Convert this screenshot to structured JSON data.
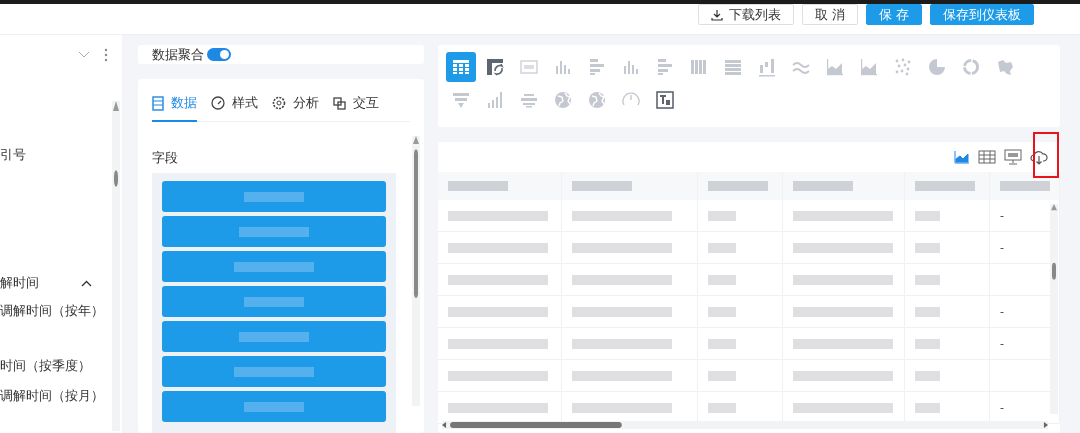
{
  "header": {
    "buttons": [
      {
        "label": "下载列表",
        "kind": "download"
      },
      {
        "label": "取 消",
        "kind": "plain"
      },
      {
        "label": "保 存",
        "kind": "primary"
      },
      {
        "label": "保存到仪表板",
        "kind": "primary"
      }
    ]
  },
  "sidebar": {
    "items": [
      {
        "label": "引号",
        "kind": "item"
      },
      {
        "label": "解时间",
        "kind": "group",
        "expanded": true
      },
      {
        "label": "调解时间（按年）",
        "kind": "item"
      },
      {
        "label": "时间（按季度）",
        "kind": "item"
      },
      {
        "label": "调解时间（按月）",
        "kind": "item"
      }
    ]
  },
  "aggregation": {
    "label": "数据聚合",
    "on": true
  },
  "tabs": [
    {
      "label": "数据",
      "kind": "data",
      "selected": true
    },
    {
      "label": "样式",
      "kind": "style",
      "selected": false
    },
    {
      "label": "分析",
      "kind": "analysis",
      "selected": false
    },
    {
      "label": "交互",
      "kind": "interaction",
      "selected": false
    }
  ],
  "fields": {
    "label": "字段"
  },
  "chart_types": [
    {
      "kind": "table",
      "selected": true,
      "disabled": false
    },
    {
      "kind": "pivot",
      "selected": false,
      "disabled": false
    },
    {
      "kind": "number",
      "selected": false,
      "disabled": true
    },
    {
      "kind": "column",
      "selected": false,
      "disabled": true
    },
    {
      "kind": "hbar",
      "selected": false,
      "disabled": true
    },
    {
      "kind": "column",
      "selected": false,
      "disabled": true
    },
    {
      "kind": "hbar",
      "selected": false,
      "disabled": true
    },
    {
      "kind": "vstripes",
      "selected": false,
      "disabled": true
    },
    {
      "kind": "hstripes",
      "selected": false,
      "disabled": true
    },
    {
      "kind": "waterfall",
      "selected": false,
      "disabled": true
    },
    {
      "kind": "wave",
      "selected": false,
      "disabled": true
    },
    {
      "kind": "area",
      "selected": false,
      "disabled": true
    },
    {
      "kind": "area",
      "selected": false,
      "disabled": true
    },
    {
      "kind": "scatter",
      "selected": false,
      "disabled": true
    },
    {
      "kind": "pie",
      "selected": false,
      "disabled": true
    },
    {
      "kind": "donut",
      "selected": false,
      "disabled": true
    },
    {
      "kind": "map",
      "selected": false,
      "disabled": true
    },
    {
      "kind": "funnel",
      "selected": false,
      "disabled": true
    },
    {
      "kind": "steps",
      "selected": false,
      "disabled": true
    },
    {
      "kind": "cloud",
      "selected": false,
      "disabled": true
    },
    {
      "kind": "globe",
      "selected": false,
      "disabled": true
    },
    {
      "kind": "globe",
      "selected": false,
      "disabled": true
    },
    {
      "kind": "gauge",
      "selected": false,
      "disabled": true
    },
    {
      "kind": "textcard",
      "selected": false,
      "disabled": false
    }
  ],
  "table": {
    "rows": [
      {
        "column_6": "-"
      },
      {
        "column_6": "-"
      },
      {},
      {
        "column_6": "-"
      },
      {
        "column_6": "-"
      },
      {},
      {
        "column_6": "-"
      }
    ]
  }
}
